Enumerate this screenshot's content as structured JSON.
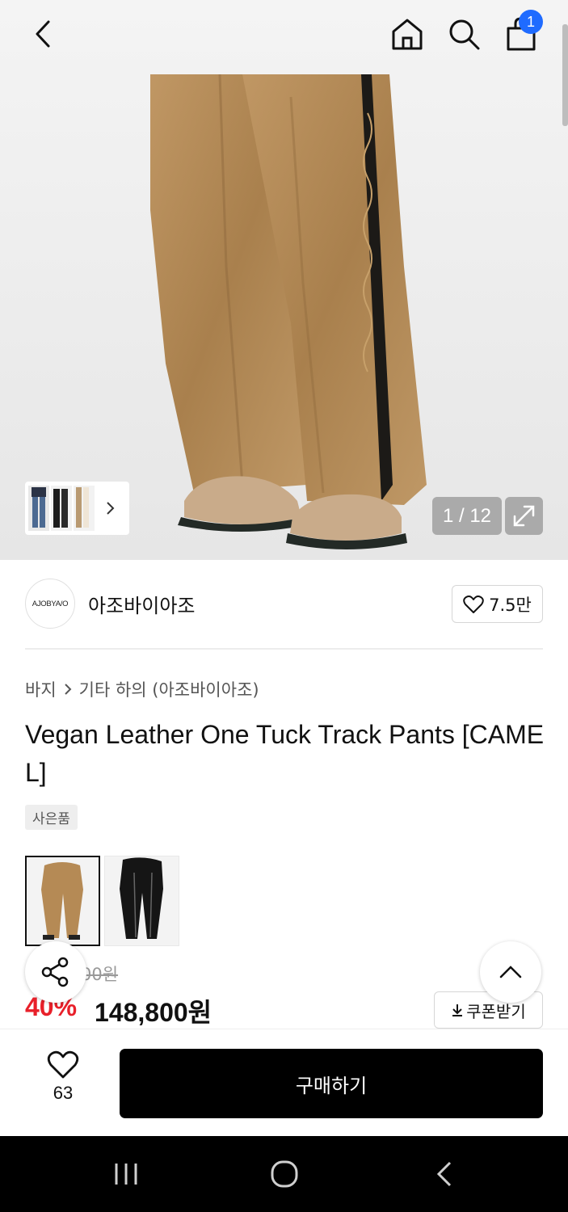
{
  "header": {
    "cart_count": "1"
  },
  "gallery": {
    "counter": "1 / 12",
    "icons": [
      "back-icon",
      "home-icon",
      "search-icon",
      "shopping-bag-icon",
      "expand-icon",
      "chevron-right-icon"
    ]
  },
  "brand": {
    "logo_text": "AJOBYA/O",
    "name": "아조바이아조",
    "likes": "7.5만"
  },
  "product": {
    "breadcrumb": [
      "바지",
      "기타 하의 (아조바이아조)"
    ],
    "title": "Vegan Leather One Tuck Track Pants [CAMEL]",
    "badge": "사은품",
    "variants": [
      "camel",
      "black"
    ],
    "original_price_visible": "00원",
    "discount": "40%",
    "price": "148,800원"
  },
  "actions": {
    "coupon_label": "쿠폰받기",
    "wish_count": "63",
    "buy_label": "구매하기"
  },
  "colors": {
    "accent_blue": "#1f6bff",
    "discount_red": "#e8202a",
    "buy_button": "#000000",
    "product_camel": "#b58a55"
  }
}
